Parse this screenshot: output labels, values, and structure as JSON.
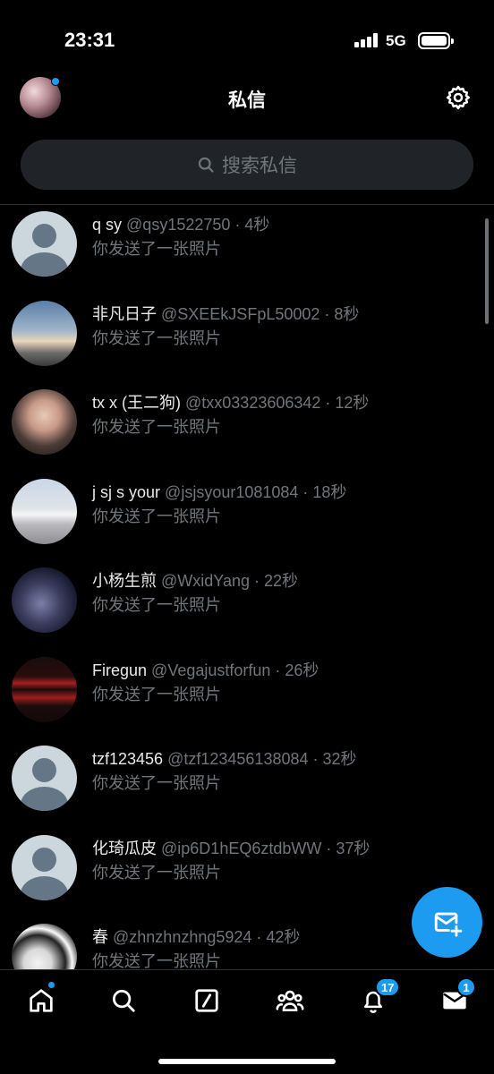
{
  "status_bar": {
    "time": "23:31",
    "network": "5G"
  },
  "header": {
    "title": "私信"
  },
  "search": {
    "placeholder": "搜索私信"
  },
  "conversations": [
    {
      "name": "q sy",
      "meta": "@qsy1522750 · 4秒",
      "preview": "你发送了一张照片",
      "avatar": "default"
    },
    {
      "name": "非凡日子",
      "meta": "@SXEEkJSFpL50002 · 8秒",
      "preview": "你发送了一张照片",
      "avatar": "sky-photo"
    },
    {
      "name": "tx x (王二狗)",
      "meta": "@txx03323606342 · 12秒",
      "preview": "你发送了一张照片",
      "avatar": "person-photo"
    },
    {
      "name": "j sj s your",
      "meta": "@jsjsyour1081084 · 18秒",
      "preview": "你发送了一张照片",
      "avatar": "car-photo"
    },
    {
      "name": "小杨生煎",
      "meta": "@WxidYang · 22秒",
      "preview": "你发送了一张照片",
      "avatar": "dark-photo"
    },
    {
      "name": "Firegun",
      "meta": "@Vegajustforfun · 26秒",
      "preview": "你发送了一张照片",
      "avatar": "emotion-photo"
    },
    {
      "name": "tzf123456",
      "meta": "@tzf123456138084 · 32秒",
      "preview": "你发送了一张照片",
      "avatar": "default"
    },
    {
      "name": "化琦瓜皮",
      "meta": "@ip6D1hEQ6ztdbWW · 37秒",
      "preview": "你发送了一张照片",
      "avatar": "default"
    },
    {
      "name": "春",
      "meta": "@zhnzhnzhng5924 · 42秒",
      "preview": "你发送了一张照片",
      "avatar": "bw-photo"
    }
  ],
  "tabbar": {
    "notifications_badge": "17",
    "messages_badge": "1"
  },
  "colors": {
    "accent": "#1d9bf0",
    "background": "#000000",
    "muted": "#71767b"
  },
  "icons": [
    "settings-gear-icon",
    "search-icon",
    "home-icon",
    "grok-icon",
    "communities-icon",
    "bell-icon",
    "mail-icon",
    "new-message-icon"
  ]
}
